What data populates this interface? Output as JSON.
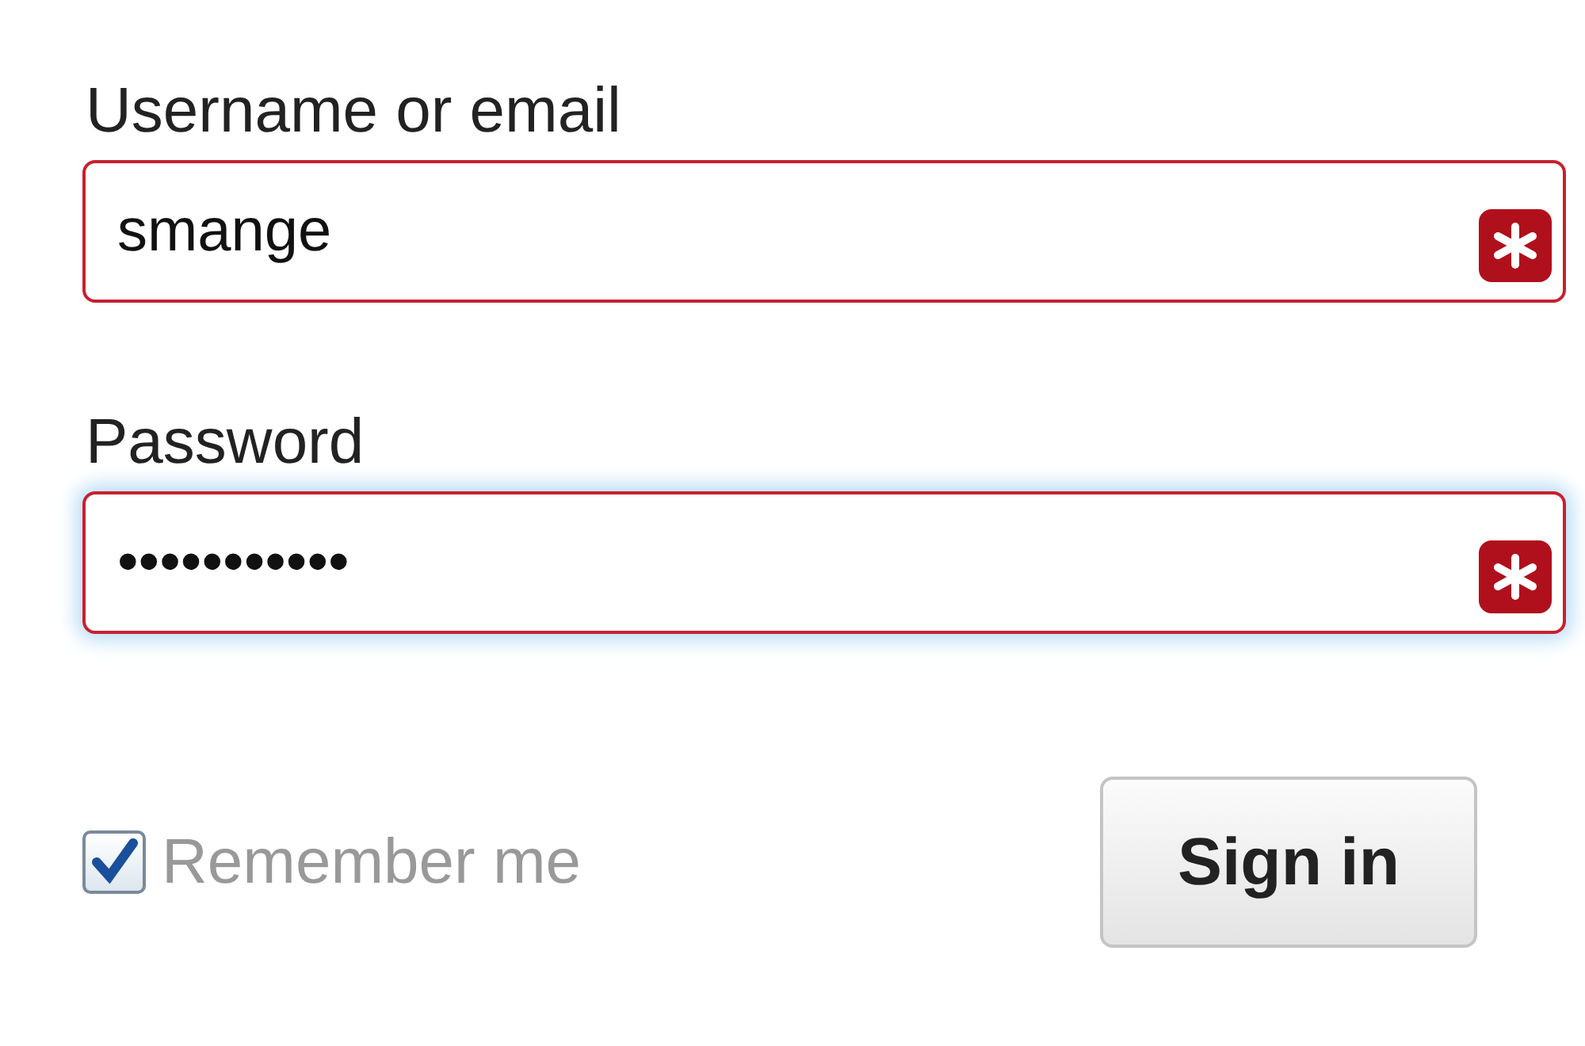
{
  "fields": [
    {
      "label": "Username or email",
      "value": "smange",
      "focused": false
    },
    {
      "label": "Password",
      "value": "•••••••••••",
      "focused": true
    }
  ],
  "remember": {
    "label": "Remember me",
    "checked": true
  },
  "submit": {
    "label": "Sign in"
  }
}
